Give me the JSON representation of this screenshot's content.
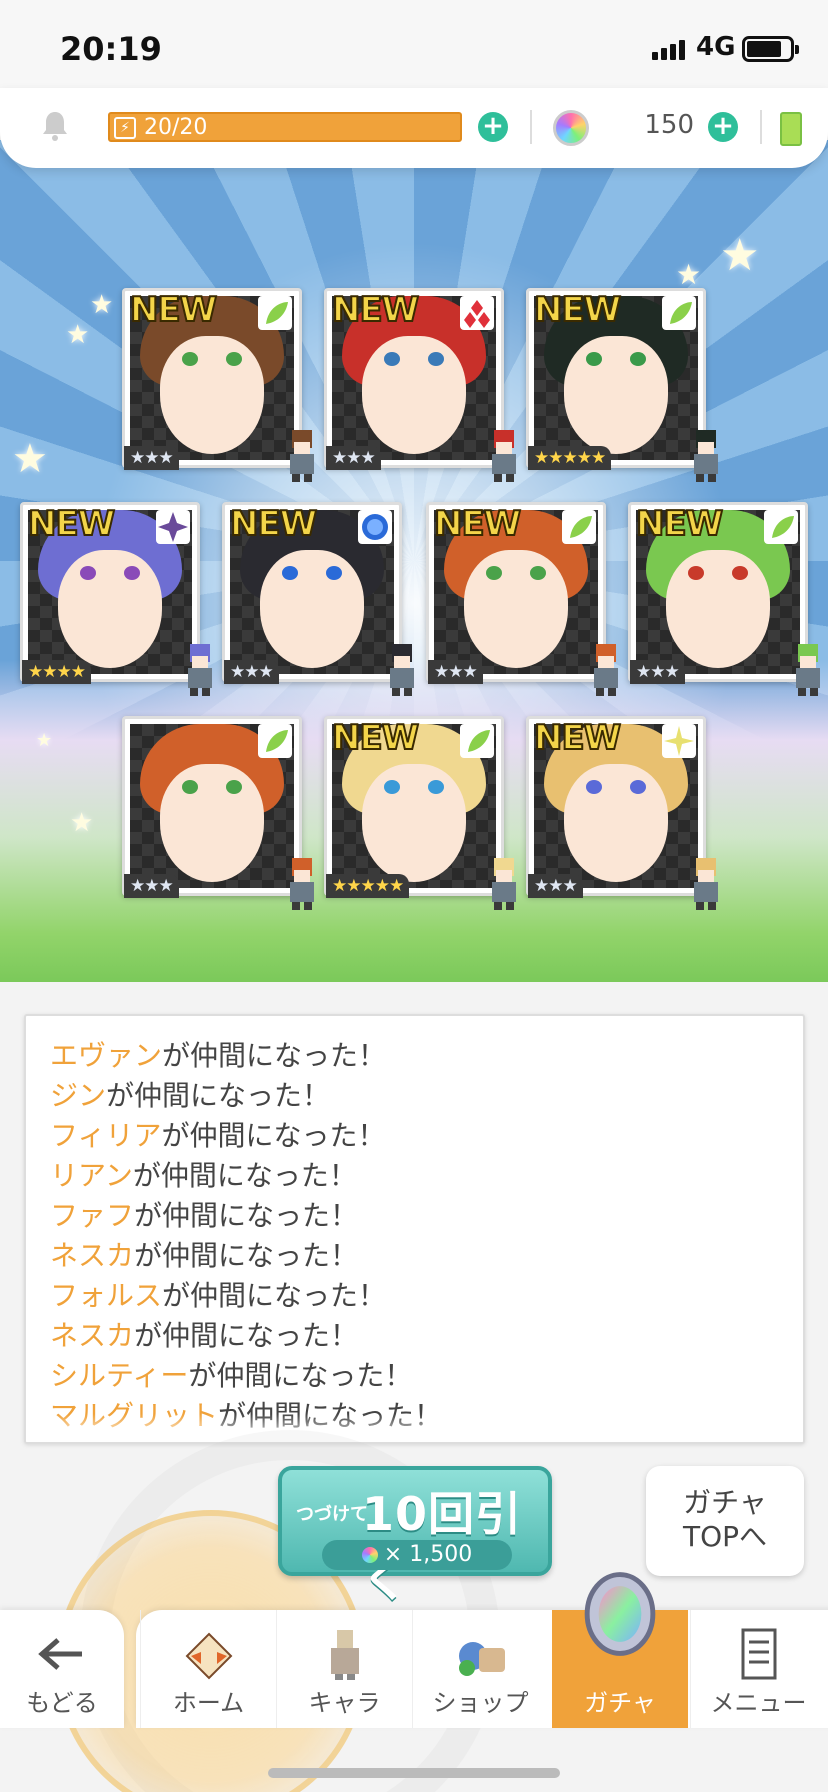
{
  "status_bar": {
    "time": "20:19",
    "network": "4G"
  },
  "resources": {
    "stamina": "20/20",
    "gem_count": "150"
  },
  "cards": [
    {
      "new": "NEW",
      "element": "leaf-icon",
      "stars": "★★★",
      "rarity": 3,
      "hair": "#7a4a2a",
      "eye": "#4aa24a"
    },
    {
      "new": "NEW",
      "element": "fire-icon",
      "stars": "★★★",
      "rarity": 3,
      "hair": "#c8302a",
      "eye": "#3a7ab8"
    },
    {
      "new": "NEW",
      "element": "leaf-icon",
      "stars": "★★★★★",
      "rarity": 5,
      "hair": "#1f2a24",
      "eye": "#3a9a4a"
    },
    {
      "new": "NEW",
      "element": "dark-icon",
      "stars": "★★★★",
      "rarity": 4,
      "hair": "#6e6ed2",
      "eye": "#8a4ab8"
    },
    {
      "new": "NEW",
      "element": "water-icon",
      "stars": "★★★",
      "rarity": 3,
      "hair": "#2a2a30",
      "eye": "#2a6ad8"
    },
    {
      "new": "NEW",
      "element": "leaf-icon",
      "stars": "★★★",
      "rarity": 3,
      "hair": "#d0602a",
      "eye": "#4aa24a"
    },
    {
      "new": "NEW",
      "element": "leaf-icon",
      "stars": "★★★",
      "rarity": 3,
      "hair": "#7ac850",
      "eye": "#c83a2a"
    },
    {
      "new": "",
      "element": "leaf-icon",
      "stars": "★★★",
      "rarity": 3,
      "hair": "#d0602a",
      "eye": "#4aa24a"
    },
    {
      "new": "NEW",
      "element": "leaf-icon",
      "stars": "★★★★★",
      "rarity": 5,
      "hair": "#f0d890",
      "eye": "#3a9ad8"
    },
    {
      "new": "NEW",
      "element": "light-icon",
      "stars": "★★★",
      "rarity": 3,
      "hair": "#e8c070",
      "eye": "#5a6ad8"
    }
  ],
  "log": [
    {
      "name": "エヴァン",
      "text": "が仲間になった！"
    },
    {
      "name": "ジン",
      "text": "が仲間になった！"
    },
    {
      "name": "フィリア",
      "text": "が仲間になった！"
    },
    {
      "name": "リアン",
      "text": "が仲間になった！"
    },
    {
      "name": "ファフ",
      "text": "が仲間になった！"
    },
    {
      "name": "ネスカ",
      "text": "が仲間になった！"
    },
    {
      "name": "フォルス",
      "text": "が仲間になった！"
    },
    {
      "name": "ネスカ",
      "text": "が仲間になった！"
    },
    {
      "name": "シルティー",
      "text": "が仲間になった！"
    },
    {
      "name": "マルグリット",
      "text": "が仲間になった！"
    }
  ],
  "draw_button": {
    "prefix": "つづけて",
    "label": "10回引く",
    "cost": "× 1,500"
  },
  "top_button": {
    "line1": "ガチャ",
    "line2": "TOPへ"
  },
  "nav": {
    "back": "もどる",
    "tabs": [
      {
        "label": "ホーム",
        "icon": "home-icon"
      },
      {
        "label": "キャラ",
        "icon": "character-icon"
      },
      {
        "label": "ショップ",
        "icon": "shop-icon"
      },
      {
        "label": "ガチャ",
        "icon": "gacha-icon",
        "active": true
      },
      {
        "label": "メニュー",
        "icon": "menu-icon"
      }
    ]
  },
  "colors": {
    "accent": "#f0a23a",
    "teal": "#2fbf9a",
    "name_highlight": "#f0a23a"
  }
}
